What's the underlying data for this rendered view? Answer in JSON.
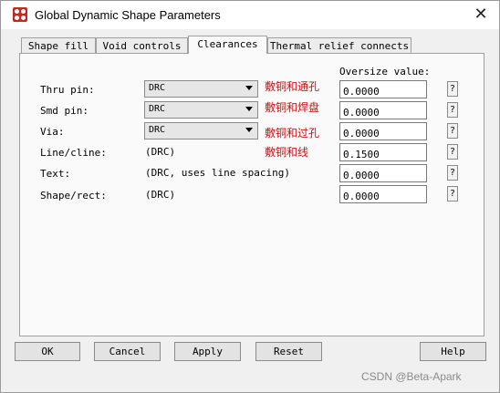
{
  "window": {
    "title": "Global Dynamic Shape Parameters",
    "close_glyph": "✕"
  },
  "tabs": [
    {
      "label": "Shape fill",
      "active": false
    },
    {
      "label": "Void controls",
      "active": false
    },
    {
      "label": "Clearances",
      "active": true
    },
    {
      "label": "Thermal relief connects",
      "active": false
    }
  ],
  "clearances": {
    "oversize_header": "Oversize value:",
    "rows": [
      {
        "label": "Thru pin:",
        "type": "combo",
        "value": "DRC",
        "annotation": "敷铜和通孔",
        "oversize": "0.0000"
      },
      {
        "label": "Smd pin:",
        "type": "combo",
        "value": "DRC",
        "annotation": "敷铜和焊盘",
        "oversize": "0.0000"
      },
      {
        "label": "Via:",
        "type": "combo",
        "value": "DRC",
        "annotation": "敷铜和过孔",
        "oversize": "0.0000"
      },
      {
        "label": "Line/cline:",
        "type": "static",
        "value": "(DRC)",
        "annotation": "敷铜和线",
        "oversize": "0.1500"
      },
      {
        "label": "Text:",
        "type": "static",
        "value": "(DRC, uses line spacing)",
        "annotation": "",
        "oversize": "0.0000"
      },
      {
        "label": "Shape/rect:",
        "type": "static",
        "value": "(DRC)",
        "annotation": "",
        "oversize": "0.0000"
      }
    ],
    "help_glyph": "?"
  },
  "buttons": {
    "ok": "OK",
    "cancel": "Cancel",
    "apply": "Apply",
    "reset": "Reset",
    "help": "Help"
  },
  "watermark": "CSDN @Beta-Apark",
  "colors": {
    "annotation": "#d01010",
    "app_icon": "#c42b1c",
    "background": "#5a0000"
  }
}
